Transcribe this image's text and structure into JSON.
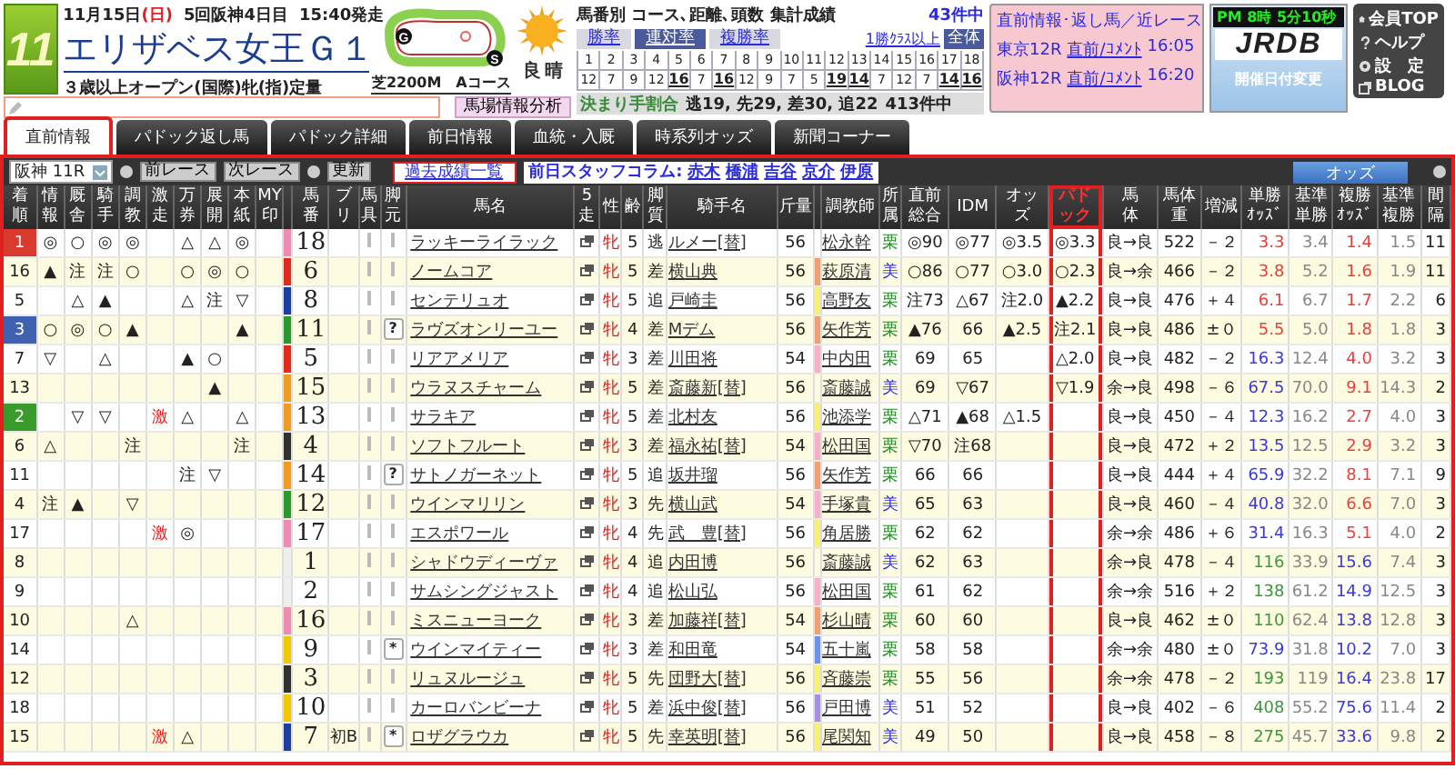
{
  "race": {
    "number": "11",
    "date": "11月15日",
    "weekday": "(日)",
    "meeting": "5回阪神4日目",
    "start": "15:40発走",
    "title": "エリザベス女王Ｇ１",
    "conditions": "３歳以上オープン(国際)牝(指)定量",
    "course": "芝2200M　Aコース",
    "goal_mark": "G",
    "start_mark": "S",
    "going": "良",
    "weather": "晴"
  },
  "track_button": "馬場情報分析",
  "stats": {
    "title": "馬番別 コース､距離､頭数 集計成績",
    "count": "43件中",
    "tabs": [
      {
        "label": "勝率",
        "selected": false
      },
      {
        "label": "連対率",
        "selected": true
      },
      {
        "label": "複勝率",
        "selected": false
      }
    ],
    "filter_link": "1勝ｸﾗｽ以上",
    "all_button": "全体",
    "numbers": [
      "1",
      "2",
      "3",
      "4",
      "5",
      "6",
      "7",
      "8",
      "9",
      "10",
      "11",
      "12",
      "13",
      "14",
      "15",
      "16",
      "17",
      "18"
    ],
    "values": [
      {
        "value": "12",
        "highlight": false
      },
      {
        "value": "7",
        "highlight": false
      },
      {
        "value": "9",
        "highlight": false
      },
      {
        "value": "12",
        "highlight": false
      },
      {
        "value": "16",
        "highlight": true
      },
      {
        "value": "7",
        "highlight": false
      },
      {
        "value": "16",
        "highlight": true
      },
      {
        "value": "12",
        "highlight": false
      },
      {
        "value": "9",
        "highlight": false
      },
      {
        "value": "7",
        "highlight": false
      },
      {
        "value": "5",
        "highlight": false
      },
      {
        "value": "19",
        "highlight": true
      },
      {
        "value": "14",
        "highlight": true
      },
      {
        "value": "7",
        "highlight": false
      },
      {
        "value": "12",
        "highlight": false
      },
      {
        "value": "7",
        "highlight": false
      },
      {
        "value": "14",
        "highlight": true
      },
      {
        "value": "16",
        "highlight": true
      }
    ],
    "finish_label": "決まり手割合",
    "finish_summary": "逃19, 先29, 差30, 追22",
    "finish_count": "413件中"
  },
  "notice": {
    "title": "直前情報･返し馬／近レース",
    "races": [
      {
        "race": "東京12R",
        "link": "直前/ｺﾒﾝﾄ",
        "time": "16:05"
      },
      {
        "race": "阪神12R",
        "link": "直前/ｺﾒﾝﾄ",
        "time": "16:20"
      }
    ]
  },
  "clock": {
    "ampm": "PM",
    "time": "8時 5分10秒"
  },
  "logo": "JRDB",
  "date_change_button": "開催日付変更",
  "menu": [
    {
      "label": "会員TOP",
      "kind": "home"
    },
    {
      "label": "ヘルプ",
      "kind": "help"
    },
    {
      "label": "設　定",
      "kind": "settings"
    },
    {
      "label": "BLOG",
      "kind": "blog"
    }
  ],
  "tabs": [
    {
      "label": "直前情報",
      "selected": true
    },
    {
      "label": "パドック返し馬",
      "selected": false
    },
    {
      "label": "パドック詳細",
      "selected": false
    },
    {
      "label": "前日情報",
      "selected": false
    },
    {
      "label": "血統・入厩",
      "selected": false
    },
    {
      "label": "時系列オッズ",
      "selected": false
    },
    {
      "label": "新聞コーナー",
      "selected": false
    }
  ],
  "toolbar": {
    "race_select": "阪神 11R",
    "prev": "前レース",
    "next": "次レース",
    "refresh": "更新",
    "history": "過去成績一覧",
    "column_label": "前日スタッフコラム:",
    "columnists": [
      "赤木",
      "橋浦",
      "吉谷",
      "京介",
      "伊原"
    ],
    "odds_button": "オッズ"
  },
  "columns": [
    {
      "lines": [
        "着",
        "順"
      ]
    },
    {
      "lines": [
        "情",
        "報"
      ]
    },
    {
      "lines": [
        "厩",
        "舎"
      ]
    },
    {
      "lines": [
        "騎",
        "手"
      ]
    },
    {
      "lines": [
        "調",
        "教"
      ]
    },
    {
      "lines": [
        "激",
        "走"
      ]
    },
    {
      "lines": [
        "万",
        "券"
      ]
    },
    {
      "lines": [
        "展",
        "開"
      ]
    },
    {
      "lines": [
        "本",
        "紙"
      ]
    },
    {
      "lines": [
        "MY",
        "印"
      ]
    },
    {
      "lines": [
        "馬",
        "番"
      ]
    },
    {
      "lines": [
        "ブ",
        "リ"
      ]
    },
    {
      "lines": [
        "馬",
        "具"
      ]
    },
    {
      "lines": [
        "脚",
        "元"
      ]
    },
    {
      "lines": [
        "馬名"
      ]
    },
    {
      "lines": [
        "5",
        "走"
      ]
    },
    {
      "lines": [
        "性"
      ]
    },
    {
      "lines": [
        "齢"
      ]
    },
    {
      "lines": [
        "脚",
        "質"
      ]
    },
    {
      "lines": [
        "騎手名"
      ]
    },
    {
      "lines": [
        "斤量"
      ]
    },
    {
      "lines": [
        "調教師"
      ]
    },
    {
      "lines": [
        "所",
        "属"
      ]
    },
    {
      "lines": [
        "直前",
        "総合"
      ]
    },
    {
      "lines": [
        "IDM"
      ]
    },
    {
      "lines": [
        "オッ",
        "ズ"
      ]
    },
    {
      "lines": [
        "パド",
        "ック"
      ],
      "highlight": true
    },
    {
      "lines": [
        "馬",
        "体"
      ]
    },
    {
      "lines": [
        "馬体",
        "重"
      ]
    },
    {
      "lines": [
        "増減"
      ]
    },
    {
      "lines": [
        "単勝",
        "ｵｯｽﾞ"
      ]
    },
    {
      "lines": [
        "基準",
        "単勝"
      ]
    },
    {
      "lines": [
        "複勝",
        "ｵｯｽﾞ"
      ]
    },
    {
      "lines": [
        "基準",
        "複勝"
      ]
    },
    {
      "lines": [
        "間",
        "隔"
      ]
    }
  ],
  "rows": [
    {
      "finish": {
        "text": "1",
        "color": "#d83a2e"
      },
      "marks": {
        "info": "◎",
        "stable": "○",
        "jockey": "◎",
        "training": "◎",
        "longshot": "△",
        "pace": "△",
        "paper": "◎"
      },
      "frame": {
        "color": "#f08cb4"
      },
      "number": "18",
      "name": "ラッキーライラック",
      "sex": "牝",
      "age": "5",
      "style": "逃",
      "jockey": "ルメー[替]",
      "weight": "56",
      "trainer": {
        "name": "松永幹"
      },
      "affiliation": {
        "text": "栗",
        "color": "#2e8b2e"
      },
      "overall": "◎90",
      "idm": "◎77",
      "odds": "◎3.5",
      "paddock": "◎3.3",
      "condition": "良→良",
      "body_weight": "522",
      "change": "－２",
      "win_odds": {
        "text": "3.3",
        "color": "#e8413c"
      },
      "base_win": "3.4",
      "show_odds": {
        "text": "1.4",
        "color": "#e8413c"
      },
      "base_show": "1.5",
      "interval": "11"
    },
    {
      "finish": {
        "text": "16"
      },
      "marks": {
        "info": "▲",
        "stable": "注",
        "jockey": "注",
        "training": "○",
        "longshot": "○",
        "pace": "◎",
        "paper": "○"
      },
      "frame": {
        "color": "#e02a1a"
      },
      "number": "6",
      "name": "ノームコア",
      "sex": "牝",
      "age": "5",
      "style": "差",
      "jockey": "横山典",
      "weight": "56",
      "trainer": {
        "name": "萩原清",
        "color": "#f0a070"
      },
      "affiliation": {
        "text": "美",
        "color": "#2a2ae0"
      },
      "overall": "○86",
      "idm": "○77",
      "odds": "○3.0",
      "paddock": "○2.3",
      "condition": "良→余",
      "body_weight": "466",
      "change": "－２",
      "win_odds": {
        "text": "3.8",
        "color": "#e8413c"
      },
      "base_win": "5.2",
      "show_odds": {
        "text": "1.6",
        "color": "#e8413c"
      },
      "base_show": "1.9",
      "interval": "11"
    },
    {
      "finish": {
        "text": "5"
      },
      "marks": {
        "stable": "△",
        "jockey": "▲",
        "longshot": "△",
        "pace": "注",
        "paper": "▽"
      },
      "frame": {
        "color": "#1a3fa0"
      },
      "number": "8",
      "name": "センテリュオ",
      "sex": "牝",
      "age": "5",
      "style": "追",
      "jockey": "戸崎圭",
      "weight": "56",
      "trainer": {
        "name": "高野友",
        "color": "#f8f070"
      },
      "affiliation": {
        "text": "栗",
        "color": "#2e8b2e"
      },
      "overall": "注73",
      "idm": "△67",
      "odds": "注2.0",
      "paddock": "▲2.2",
      "condition": "良→良",
      "body_weight": "476",
      "change": "＋４",
      "win_odds": {
        "text": "6.1",
        "color": "#e8413c"
      },
      "base_win": "6.7",
      "show_odds": {
        "text": "1.7",
        "color": "#e8413c"
      },
      "base_show": "2.2",
      "interval": "6"
    },
    {
      "finish": {
        "text": "3",
        "color": "#4060b0"
      },
      "marks": {
        "info": "○",
        "stable": "◎",
        "jockey": "○",
        "training": "▲",
        "paper": "▲"
      },
      "frame": {
        "color": "#2a9a2a"
      },
      "number": "11",
      "leg": "?",
      "name": "ラヴズオンリーユー",
      "sex": "牝",
      "age": "4",
      "style": "差",
      "jockey": "Mデム",
      "weight": "56",
      "trainer": {
        "name": "矢作芳",
        "color": "#f0a070"
      },
      "affiliation": {
        "text": "栗",
        "color": "#2e8b2e"
      },
      "overall": "▲76",
      "idm": "66",
      "odds": "▲2.5",
      "paddock": "注2.1",
      "condition": "良→良",
      "body_weight": "486",
      "change": "±０",
      "win_odds": {
        "text": "5.5",
        "color": "#e8413c"
      },
      "base_win": "5.0",
      "show_odds": {
        "text": "1.8",
        "color": "#e8413c"
      },
      "base_show": "1.8",
      "interval": "3"
    },
    {
      "finish": {
        "text": "7"
      },
      "marks": {
        "info": "▽",
        "jockey": "△",
        "longshot": "▲",
        "pace": "○"
      },
      "frame": {
        "color": "#e02a1a"
      },
      "number": "5",
      "name": "リアアメリア",
      "sex": "牝",
      "age": "3",
      "style": "差",
      "jockey": "川田将",
      "weight": "54",
      "trainer": {
        "name": "中内田",
        "color": "#f8b0c8"
      },
      "affiliation": {
        "text": "栗",
        "color": "#2e8b2e"
      },
      "overall": "69",
      "idm": "65",
      "paddock": "△2.0",
      "condition": "良→良",
      "body_weight": "482",
      "change": "－２",
      "win_odds": {
        "text": "16.3",
        "color": "#3a3ae0"
      },
      "base_win": "12.4",
      "show_odds": {
        "text": "4.0",
        "color": "#e8413c"
      },
      "base_show": "3.2",
      "interval": "3"
    },
    {
      "finish": {
        "text": "13"
      },
      "marks": {
        "pace": "▲"
      },
      "frame": {
        "color": "#f09a20"
      },
      "number": "15",
      "name": "ウラヌスチャーム",
      "sex": "牝",
      "age": "5",
      "style": "差",
      "jockey": "斎藤新[替]",
      "weight": "56",
      "trainer": {
        "name": "斎藤誠"
      },
      "affiliation": {
        "text": "美",
        "color": "#2a2ae0"
      },
      "overall": "69",
      "idm": "▽67",
      "paddock": "▽1.9",
      "condition": "余→良",
      "body_weight": "498",
      "change": "－６",
      "win_odds": {
        "text": "67.5",
        "color": "#3a3ae0"
      },
      "base_win": "70.0",
      "show_odds": {
        "text": "9.1",
        "color": "#e8413c"
      },
      "base_show": "14.3",
      "interval": "2"
    },
    {
      "finish": {
        "text": "2",
        "color": "#3a9a2a"
      },
      "marks": {
        "stable": "▽",
        "jockey": "▽",
        "surge": "激",
        "longshot": "△",
        "paper": "△"
      },
      "frame": {
        "color": "#f09a20"
      },
      "number": "13",
      "name": "サラキア",
      "sex": "牝",
      "age": "5",
      "style": "差",
      "jockey": "北村友",
      "weight": "56",
      "trainer": {
        "name": "池添学",
        "color": "#f8f070"
      },
      "affiliation": {
        "text": "栗",
        "color": "#2e8b2e"
      },
      "overall": "△71",
      "idm": "▲68",
      "odds": "△1.5",
      "condition": "良→良",
      "body_weight": "450",
      "change": "－４",
      "win_odds": {
        "text": "12.3",
        "color": "#3a3ae0"
      },
      "base_win": "16.2",
      "show_odds": {
        "text": "2.7",
        "color": "#e8413c"
      },
      "base_show": "4.0",
      "interval": "3"
    },
    {
      "finish": {
        "text": "6"
      },
      "marks": {
        "info": "△",
        "training": "注",
        "paper": "注"
      },
      "frame": {
        "color": "#303030"
      },
      "number": "4",
      "name": "ソフトフルート",
      "sex": "牝",
      "age": "3",
      "style": "差",
      "jockey": "福永祐[替]",
      "weight": "54",
      "trainer": {
        "name": "松田国",
        "color": "#f8b0c8"
      },
      "affiliation": {
        "text": "栗",
        "color": "#2e8b2e"
      },
      "overall": "▽70",
      "idm": "注68",
      "condition": "良→良",
      "body_weight": "472",
      "change": "＋２",
      "win_odds": {
        "text": "13.5",
        "color": "#3a3ae0"
      },
      "base_win": "12.5",
      "show_odds": {
        "text": "2.9",
        "color": "#e8413c"
      },
      "base_show": "3.2",
      "interval": "3"
    },
    {
      "finish": {
        "text": "11"
      },
      "marks": {
        "longshot": "注",
        "pace": "▽"
      },
      "frame": {
        "color": "#f09a20"
      },
      "number": "14",
      "leg": "?",
      "name": "サトノガーネット",
      "sex": "牝",
      "age": "5",
      "style": "追",
      "jockey": "坂井瑠",
      "weight": "56",
      "trainer": {
        "name": "矢作芳",
        "color": "#f0a070"
      },
      "affiliation": {
        "text": "栗",
        "color": "#2e8b2e"
      },
      "overall": "66",
      "idm": "66",
      "condition": "良→良",
      "body_weight": "444",
      "change": "＋４",
      "win_odds": {
        "text": "65.9",
        "color": "#3a3ae0"
      },
      "base_win": "32.2",
      "show_odds": {
        "text": "8.1",
        "color": "#e8413c"
      },
      "base_show": "7.1",
      "interval": "9"
    },
    {
      "finish": {
        "text": "4"
      },
      "marks": {
        "info": "注",
        "stable": "▲",
        "training": "▽"
      },
      "frame": {
        "color": "#2a9a2a"
      },
      "number": "12",
      "name": "ウインマリリン",
      "sex": "牝",
      "age": "3",
      "style": "先",
      "jockey": "横山武",
      "weight": "54",
      "trainer": {
        "name": "手塚貴",
        "color": "#f8b0c8"
      },
      "affiliation": {
        "text": "美",
        "color": "#2a2ae0"
      },
      "overall": "65",
      "idm": "63",
      "condition": "良→良",
      "body_weight": "460",
      "change": "－４",
      "win_odds": {
        "text": "40.8",
        "color": "#3a3ae0"
      },
      "base_win": "32.0",
      "show_odds": {
        "text": "6.6",
        "color": "#e8413c"
      },
      "base_show": "7.0",
      "interval": "3"
    },
    {
      "finish": {
        "text": "17"
      },
      "marks": {
        "surge": "激",
        "longshot": "◎"
      },
      "frame": {
        "color": "#f08cb4"
      },
      "number": "17",
      "name": "エスポワール",
      "sex": "牝",
      "age": "4",
      "style": "先",
      "jockey": "武　豊[替]",
      "weight": "56",
      "trainer": {
        "name": "角居勝",
        "color": "#f8f070"
      },
      "affiliation": {
        "text": "栗",
        "color": "#2e8b2e"
      },
      "overall": "62",
      "idm": "62",
      "condition": "余→余",
      "body_weight": "486",
      "change": "＋６",
      "win_odds": {
        "text": "31.4",
        "color": "#3a3ae0"
      },
      "base_win": "16.3",
      "show_odds": {
        "text": "5.1",
        "color": "#e8413c"
      },
      "base_show": "4.0",
      "interval": "2"
    },
    {
      "finish": {
        "text": "8"
      },
      "marks": {},
      "frame": {
        "color": "#eeeeee"
      },
      "number": "1",
      "name": "シャドウディーヴァ",
      "sex": "牝",
      "age": "4",
      "style": "追",
      "jockey": "内田博",
      "weight": "56",
      "trainer": {
        "name": "斎藤誠"
      },
      "affiliation": {
        "text": "美",
        "color": "#2a2ae0"
      },
      "overall": "62",
      "idm": "63",
      "condition": "余→良",
      "body_weight": "478",
      "change": "－４",
      "win_odds": {
        "text": "116",
        "color": "#3a9a3a"
      },
      "base_win": "33.9",
      "show_odds": {
        "text": "15.6",
        "color": "#3a3ae0"
      },
      "base_show": "7.4",
      "interval": "3"
    },
    {
      "finish": {
        "text": "9"
      },
      "marks": {},
      "frame": {
        "color": "#eeeeee"
      },
      "number": "2",
      "name": "サムシングジャスト",
      "sex": "牝",
      "age": "4",
      "style": "追",
      "jockey": "松山弘",
      "weight": "56",
      "trainer": {
        "name": "松田国",
        "color": "#f8b0c8"
      },
      "affiliation": {
        "text": "栗",
        "color": "#2e8b2e"
      },
      "overall": "61",
      "idm": "62",
      "condition": "余→余",
      "body_weight": "516",
      "change": "＋２",
      "win_odds": {
        "text": "138",
        "color": "#3a9a3a"
      },
      "base_win": "61.2",
      "show_odds": {
        "text": "14.9",
        "color": "#3a3ae0"
      },
      "base_show": "12.5",
      "interval": "3"
    },
    {
      "finish": {
        "text": "10"
      },
      "marks": {
        "training": "△"
      },
      "frame": {
        "color": "#f08cb4"
      },
      "number": "16",
      "name": "ミスニューヨーク",
      "sex": "牝",
      "age": "3",
      "style": "差",
      "jockey": "加藤祥[替]",
      "weight": "54",
      "trainer": {
        "name": "杉山晴",
        "color": "#f0a070"
      },
      "affiliation": {
        "text": "栗",
        "color": "#2e8b2e"
      },
      "overall": "60",
      "idm": "60",
      "condition": "良→良",
      "body_weight": "462",
      "change": "±０",
      "win_odds": {
        "text": "110",
        "color": "#3a9a3a"
      },
      "base_win": "62.4",
      "show_odds": {
        "text": "13.8",
        "color": "#3a3ae0"
      },
      "base_show": "12.8",
      "interval": "3"
    },
    {
      "finish": {
        "text": "14"
      },
      "marks": {},
      "frame": {
        "color": "#f0c800"
      },
      "number": "9",
      "leg": "*",
      "name": "ウインマイティー",
      "sex": "牝",
      "age": "3",
      "style": "差",
      "jockey": "和田竜",
      "weight": "54",
      "trainer": {
        "name": "五十嵐",
        "color": "#6a90f0"
      },
      "affiliation": {
        "text": "栗",
        "color": "#2e8b2e"
      },
      "overall": "58",
      "idm": "58",
      "condition": "余→余",
      "body_weight": "480",
      "change": "±０",
      "win_odds": {
        "text": "73.9",
        "color": "#3a3ae0"
      },
      "base_win": "31.8",
      "show_odds": {
        "text": "10.2",
        "color": "#3a3ae0"
      },
      "base_show": "7.0",
      "interval": "3"
    },
    {
      "finish": {
        "text": "12"
      },
      "marks": {},
      "frame": {
        "color": "#303030"
      },
      "number": "3",
      "name": "リュヌルージュ",
      "sex": "牝",
      "age": "5",
      "style": "先",
      "jockey": "団野大[替]",
      "weight": "56",
      "trainer": {
        "name": "斉藤崇",
        "color": "#f8f070"
      },
      "affiliation": {
        "text": "栗",
        "color": "#2e8b2e"
      },
      "overall": "55",
      "idm": "56",
      "condition": "余→余",
      "body_weight": "478",
      "change": "－２",
      "win_odds": {
        "text": "193",
        "color": "#3a9a3a"
      },
      "base_win": "119",
      "show_odds": {
        "text": "16.4",
        "color": "#3a3ae0"
      },
      "base_show": "23.8",
      "interval": "17"
    },
    {
      "finish": {
        "text": "18"
      },
      "marks": {},
      "frame": {
        "color": "#f0c800"
      },
      "number": "10",
      "name": "カーロバンビーナ",
      "sex": "牝",
      "age": "5",
      "style": "差",
      "jockey": "浜中俊[替]",
      "weight": "56",
      "trainer": {
        "name": "戸田博",
        "color": "#a890e0"
      },
      "affiliation": {
        "text": "美",
        "color": "#2a2ae0"
      },
      "overall": "51",
      "idm": "52",
      "condition": "良→良",
      "body_weight": "402",
      "change": "－６",
      "win_odds": {
        "text": "408",
        "color": "#3a9a3a"
      },
      "base_win": "55.2",
      "show_odds": {
        "text": "75.6",
        "color": "#3a3ae0"
      },
      "base_show": "11.4",
      "interval": "2"
    },
    {
      "finish": {
        "text": "15"
      },
      "marks": {
        "surge": "激",
        "longshot": "△"
      },
      "frame": {
        "color": "#1a3fa0"
      },
      "number": "7",
      "blinker": "初B",
      "leg": "*",
      "name": "ロザグラウカ",
      "sex": "牝",
      "age": "5",
      "style": "先",
      "jockey": "幸英明[替]",
      "weight": "56",
      "trainer": {
        "name": "尾関知",
        "color": "#f8f070"
      },
      "affiliation": {
        "text": "美",
        "color": "#2a2ae0"
      },
      "overall": "49",
      "idm": "50",
      "condition": "良→良",
      "body_weight": "458",
      "change": "－８",
      "win_odds": {
        "text": "275",
        "color": "#3a9a3a"
      },
      "base_win": "45.7",
      "show_odds": {
        "text": "33.6",
        "color": "#3a3ae0"
      },
      "base_show": "9.8",
      "interval": "2"
    }
  ]
}
